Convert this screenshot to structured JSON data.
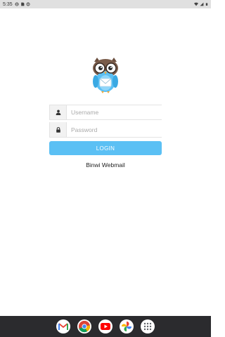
{
  "status_bar": {
    "time": "5:35",
    "left_icons": [
      "vpn-icon",
      "sim-icon",
      "vpn-icon"
    ],
    "right_icons": [
      "wifi-icon",
      "signal-icon",
      "battery-icon"
    ]
  },
  "logo": {
    "icon": "owl-mail-logo"
  },
  "form": {
    "username_placeholder": "Username",
    "username_value": "",
    "password_placeholder": "Password",
    "password_value": "",
    "login_label": "LOGIN"
  },
  "app_name": "Binwi Webmail",
  "colors": {
    "accent": "#5bc0f4",
    "dock": "#2b2b2e",
    "status_bar": "#e0e0e0"
  },
  "dock": {
    "apps": [
      "gmail-icon",
      "chrome-icon",
      "youtube-icon",
      "photos-icon",
      "app-drawer-icon"
    ]
  }
}
